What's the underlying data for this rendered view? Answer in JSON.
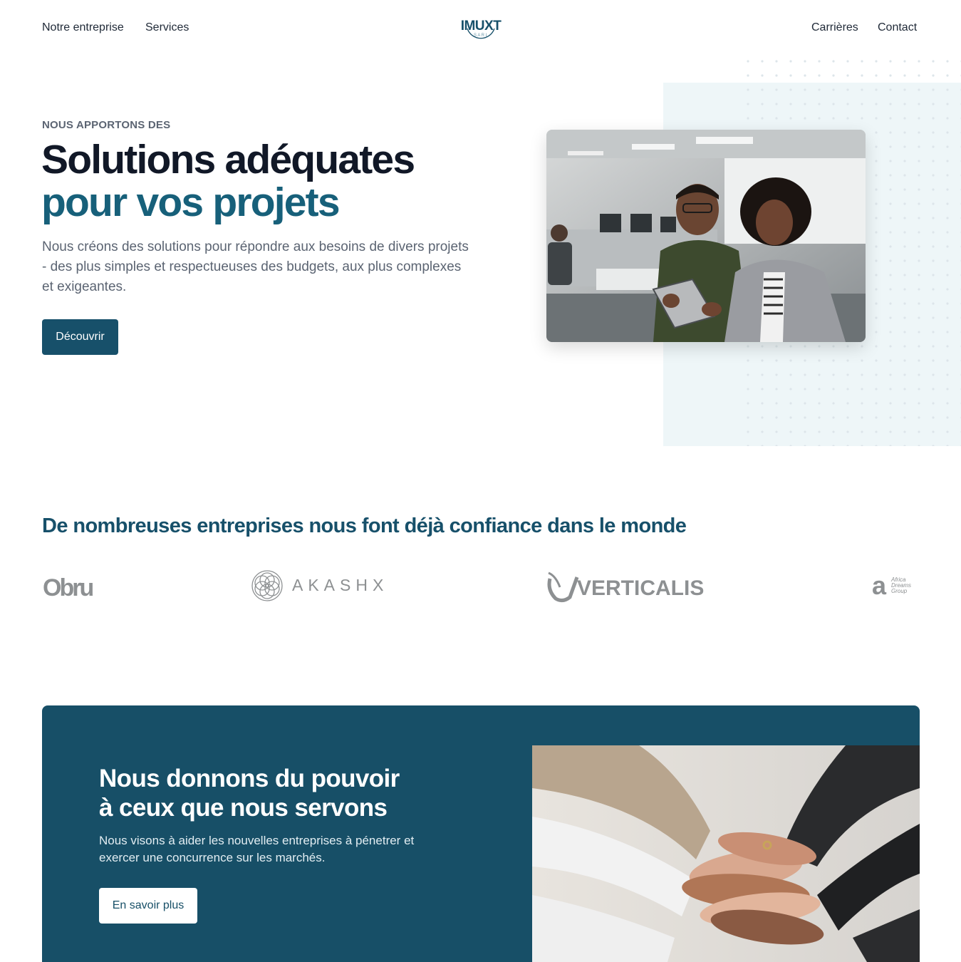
{
  "nav": {
    "left_links": [
      "Notre entreprise",
      "Services"
    ],
    "right_links": [
      "Carrières",
      "Contact"
    ],
    "logo": {
      "name": "IMUXT",
      "sub": "S A R L"
    }
  },
  "hero": {
    "eyebrow": "NOUS APPORTONS DES",
    "title_line1": "Solutions adéquates",
    "title_line2": "pour vos projets",
    "lead": "Nous créons des solutions pour répondre aux besoins de divers projets - des plus simples et respectueuses des budgets, aux plus complexes et exigeantes.",
    "button": "Découvrir"
  },
  "trust": {
    "title": "De nombreuses entreprises nous font déjà confiance dans le monde",
    "logos": [
      {
        "name": "Obru",
        "text": "Obru"
      },
      {
        "name": "Akashx",
        "text": "AKASHX"
      },
      {
        "name": "Verticalis",
        "text": "VERTICALIS"
      },
      {
        "name": "Africa Dreams Group",
        "text": "Africa Dreams Group"
      }
    ]
  },
  "cta": {
    "title_line1": "Nous donnons du pouvoir",
    "title_line2": "à ceux que nous servons",
    "text": "Nous visons à aider les nouvelles entreprises à pénetrer et exercer une concurrence sur les marchés.",
    "button": "En savoir plus"
  },
  "colors": {
    "brand": "#17506a",
    "accent": "#17607a",
    "hero_bg": "#eef6f8"
  }
}
